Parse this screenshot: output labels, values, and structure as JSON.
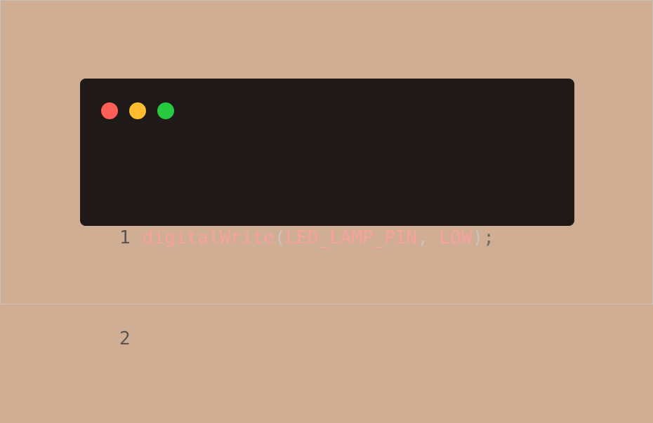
{
  "colors": {
    "background": "#d0ae94",
    "window": "#1f1a17",
    "close_dot": "#ff5f56",
    "minimize_dot": "#ffbd2e",
    "zoom_dot": "#27c93f",
    "line_number": "#5a5550",
    "identifier": "#f7a1a1",
    "punctuation": "#c9c4c0",
    "semicolon": "#6f6a66"
  },
  "window_controls": [
    {
      "name": "close",
      "icon": "red-dot-icon"
    },
    {
      "name": "minimize",
      "icon": "yellow-dot-icon"
    },
    {
      "name": "zoom",
      "icon": "green-dot-icon"
    }
  ],
  "code": {
    "lines": [
      {
        "number": "1",
        "tokens": [
          "digitalWrite",
          "(",
          "LED_LAMP_PIN",
          ",",
          " ",
          "LOW",
          ")",
          ";"
        ]
      },
      {
        "number": "2",
        "tokens": []
      }
    ]
  }
}
